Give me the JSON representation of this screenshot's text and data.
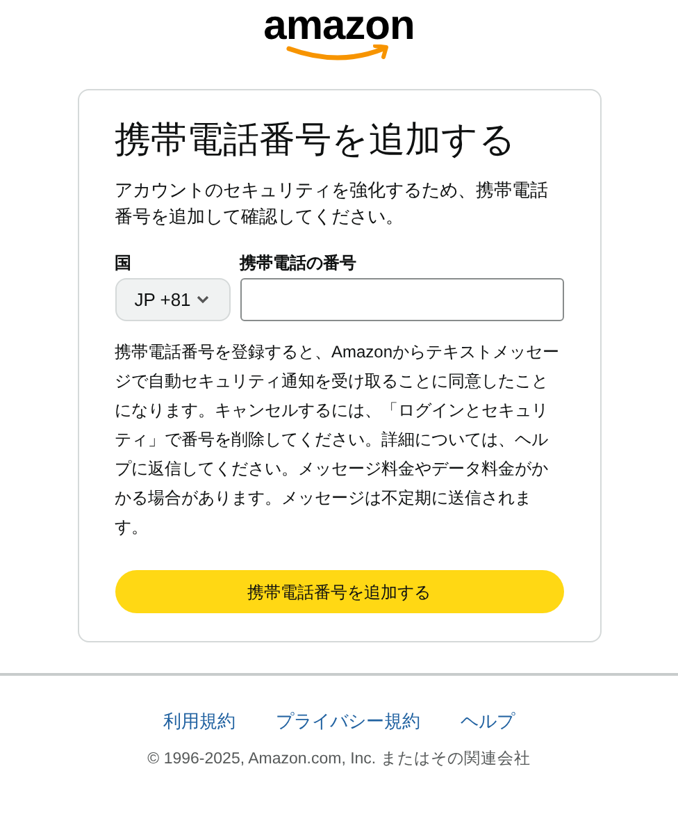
{
  "logo": {
    "text": "amazon"
  },
  "card": {
    "title": "携帯電話番号を追加する",
    "description": "アカウントのセキュリティを強化するため、携帯電話番号を追加して確認してください。",
    "country": {
      "label": "国",
      "value": "JP +81"
    },
    "phone": {
      "label": "携帯電話の番号"
    },
    "notice": "携帯電話番号を登録すると、Amazonからテキストメッセージで自動セキュリティ通知を受け取ることに同意したことになります。キャンセルするには、「ログインとセキュリティ」で番号を削除してください。詳細については、ヘルプに返信してください。メッセージ料金やデータ料金がかかる場合があります。メッセージは不定期に送信されます。",
    "submit": "携帯電話番号を追加する"
  },
  "footer": {
    "links": [
      "利用規約",
      "プライバシー規約",
      "ヘルプ"
    ],
    "copyright": "© 1996-2025, Amazon.com, Inc. またはその関連会社"
  }
}
